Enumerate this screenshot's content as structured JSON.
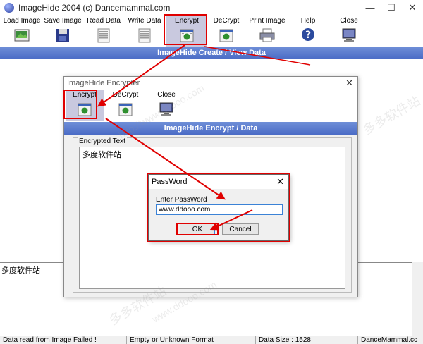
{
  "window": {
    "title": "ImageHide 2004 (c) Dancemammal.com",
    "min_glyph": "—",
    "max_glyph": "☐",
    "close_glyph": "✕"
  },
  "toolbar": {
    "items": [
      {
        "label": "Load Image",
        "icon": "load-image-icon"
      },
      {
        "label": "Save Image",
        "icon": "floppy-icon"
      },
      {
        "label": "Read Data",
        "icon": "read-data-icon"
      },
      {
        "label": "Write Data",
        "icon": "write-data-icon"
      },
      {
        "label": "Encrypt",
        "icon": "encrypt-icon"
      },
      {
        "label": "DeCrypt",
        "icon": "decrypt-icon"
      },
      {
        "label": "Print Image",
        "icon": "printer-icon"
      },
      {
        "label": "Help",
        "icon": "help-icon"
      },
      {
        "label": "Close",
        "icon": "monitor-icon"
      }
    ]
  },
  "banner": {
    "title": "ImageHide Create / View Data"
  },
  "lower_text": {
    "value": "多度软件站"
  },
  "status": {
    "message": "Data read from Image Failed !",
    "format": "Empty or Unknown Format",
    "size": "Data Size : 1528",
    "site": "DanceMammal.cc"
  },
  "encrypter": {
    "title": "ImageHide Encrypter",
    "close_glyph": "✕",
    "toolbar": [
      {
        "label": "Encrypt",
        "icon": "encrypt-icon"
      },
      {
        "label": "DeCrypt",
        "icon": "decrypt-icon"
      },
      {
        "label": "Close",
        "icon": "monitor-icon"
      }
    ],
    "banner": "ImageHide Encrypt / Data",
    "group_label": "Encrypted Text",
    "text": "多度软件站"
  },
  "password_dialog": {
    "title": "PassWord",
    "close_glyph": "✕",
    "label": "Enter PassWord",
    "value": "www.ddooo.com",
    "ok": "OK",
    "cancel": "Cancel"
  },
  "colors": {
    "banner": "#5577cc",
    "highlight": "#e00000",
    "input_border": "#3b82d6"
  },
  "watermarks": [
    "多多软件站",
    "http://www.ddooo.com",
    "www.ddooo.com"
  ]
}
